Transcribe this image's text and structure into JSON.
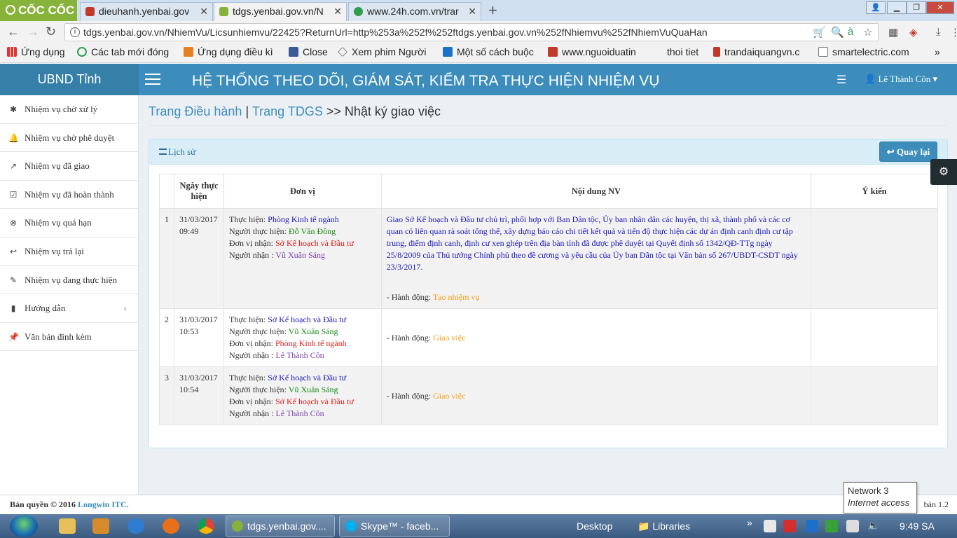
{
  "browser": {
    "logo": "CỐC CỐC",
    "tabs": [
      {
        "title": "dieuhanh.yenbai.gov"
      },
      {
        "title": "tdgs.yenbai.gov.vn/N"
      },
      {
        "title": "www.24h.com.vn/trar"
      }
    ],
    "url": "tdgs.yenbai.gov.vn/NhiemVu/Licsunhiemvu/22425?ReturnUrl=http%253a%252f%252ftdgs.yenbai.gov.vn%252fNhiemvu%252fNhiemVuQuaHan",
    "bookmarks": [
      "Ứng dụng",
      "Các tab mới đóng",
      "Ứng dụng điều kì",
      "Close",
      "Xem phim Người",
      "Một số cách buộc",
      "www.nguoiduatin",
      "thoi tiet",
      "trandaiquangvn.c",
      "smartelectric.com"
    ]
  },
  "header": {
    "brand": "UBND Tỉnh",
    "title": "HỆ THỐNG THEO DÕI, GIÁM SÁT, KIỂM TRA THỰC HIỆN NHIỆM VỤ",
    "user": "Lê Thành Côn"
  },
  "sidebar": {
    "items": [
      {
        "label": "Nhiệm vụ chờ xử lý",
        "icon": "asterisk-icon"
      },
      {
        "label": "Nhiệm vụ chờ phê duyệt",
        "icon": "bell-icon"
      },
      {
        "label": "Nhiệm vụ đã giao",
        "icon": "external-link-icon"
      },
      {
        "label": "Nhiệm vụ đã hoàn thành",
        "icon": "check-square-icon"
      },
      {
        "label": "Nhiệm vụ quá hạn",
        "icon": "times-circle-icon"
      },
      {
        "label": "Nhiệm vụ trả lại",
        "icon": "reply-icon"
      },
      {
        "label": "Nhiệm vụ đang thực hiện",
        "icon": "pencil-icon"
      },
      {
        "label": "Hướng dẫn",
        "icon": "book-icon"
      },
      {
        "label": "Văn bản đính kèm",
        "icon": "pin-icon"
      }
    ]
  },
  "breadcrumb": {
    "link1": "Trang Điều hành",
    "sep1": "|",
    "link2": "Trang TDGS",
    "sep2": ">>",
    "current": "Nhật ký giao việc"
  },
  "panel": {
    "title": "Lịch sử",
    "back_label": "Quay lại"
  },
  "table": {
    "headers": {
      "no": "",
      "date": "Ngày thực hiện",
      "unit": "Đơn vị",
      "content": "Nội dung NV",
      "opinion": "Ý kiến"
    },
    "labels": {
      "executor": "Thực hiện:",
      "executor_person": "Người thực hiện:",
      "receiver_unit": "Đơn vị nhận:",
      "receiver": "Người nhận :",
      "action": "- Hành động:"
    },
    "rows": [
      {
        "no": "1",
        "date": "31/03/2017",
        "time": "09:49",
        "executor": "Phòng Kinh tế ngành",
        "executor_person": "Đỗ Văn Đông",
        "receiver_unit": "Sở Kế hoạch và Đầu tư",
        "receiver": "Vũ Xuân Sáng",
        "content": "Giao Sở Kế hoạch và Đầu tư chủ trì, phối hợp với Ban Dân tộc, Ủy ban nhân dân các huyện, thị xã, thành phố và các cơ quan có liên quan rà soát tổng thể, xây dựng báo cáo chi tiết kết quả và tiến độ thực hiện các dự án định canh định cư tập trung, điểm định canh, định cư xen ghép trên địa bàn tỉnh đã được phê duyệt tại Quyết định số 1342/QĐ-TTg ngày 25/8/2009 của Thủ tướng Chính phủ theo đề cương và yêu cầu của Ủy ban Dân tộc tại Văn bản số 267/UBDT-CSDT ngày 23/3/2017.",
        "action": "Tạo nhiệm vụ",
        "opinion": ""
      },
      {
        "no": "2",
        "date": "31/03/2017",
        "time": "10:53",
        "executor": "Sở Kế hoạch và Đầu tư",
        "executor_person": "Vũ Xuân Sáng",
        "receiver_unit": "Phòng Kinh tế ngành",
        "receiver": "Lê Thành Côn",
        "content": "",
        "action": "Giao việc",
        "opinion": ""
      },
      {
        "no": "3",
        "date": "31/03/2017",
        "time": "10:54",
        "executor": "Sở Kế hoạch và Đầu tư",
        "executor_person": "Vũ Xuân Sáng",
        "receiver_unit": "Sở Kế hoạch và Đầu tư",
        "receiver": "Lê Thành Côn",
        "content": "",
        "action": "Giao việc",
        "opinion": ""
      }
    ]
  },
  "footer": {
    "copyright": "Bản quyền © 2016",
    "company": "Longwin ITC.",
    "version": "bản 1.2"
  },
  "tooltip": {
    "title": "Network  3",
    "subtitle": "Internet access"
  },
  "taskbar": {
    "tasks": [
      "tdgs.yenbai.gov....",
      "Skype™ - faceb..."
    ],
    "desktop": "Desktop",
    "libraries": "Libraries",
    "clock": "9:49 SA"
  }
}
